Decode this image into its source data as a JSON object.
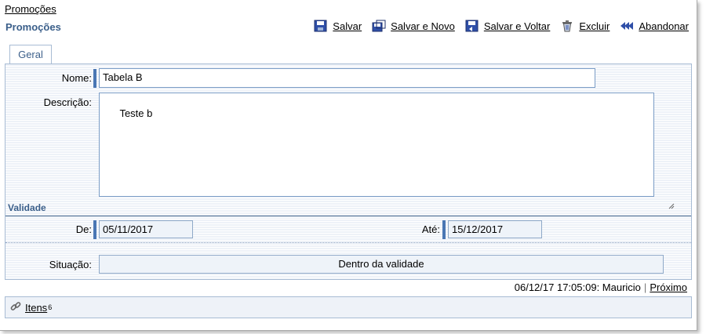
{
  "header": {
    "breadcrumb": "Promoções",
    "title": "Promoções"
  },
  "toolbar": {
    "save": "Salvar",
    "save_new": "Salvar e Novo",
    "save_back": "Salvar e Voltar",
    "delete": "Excluir",
    "abandon": "Abandonar"
  },
  "tabs": {
    "general": "Geral"
  },
  "form": {
    "name_label": "Nome:",
    "name_value": "Tabela B",
    "description_label": "Descrição:",
    "description_value": "Teste b",
    "validity_section": "Validade",
    "from_label": "De:",
    "from_value": "05/11/2017",
    "to_label": "Até:",
    "to_value": "15/12/2017",
    "status_label": "Situação:",
    "status_value": "Dentro da validade"
  },
  "footer": {
    "audit": "06/12/17 17:05:09: Mauricio",
    "separator": "|",
    "next": "Próximo"
  },
  "items": {
    "label": "Itens",
    "count": "6"
  },
  "colors": {
    "accent": "#3b5f8a",
    "marker": "#4a77b4",
    "icon_blue": "#2f4fa8"
  }
}
